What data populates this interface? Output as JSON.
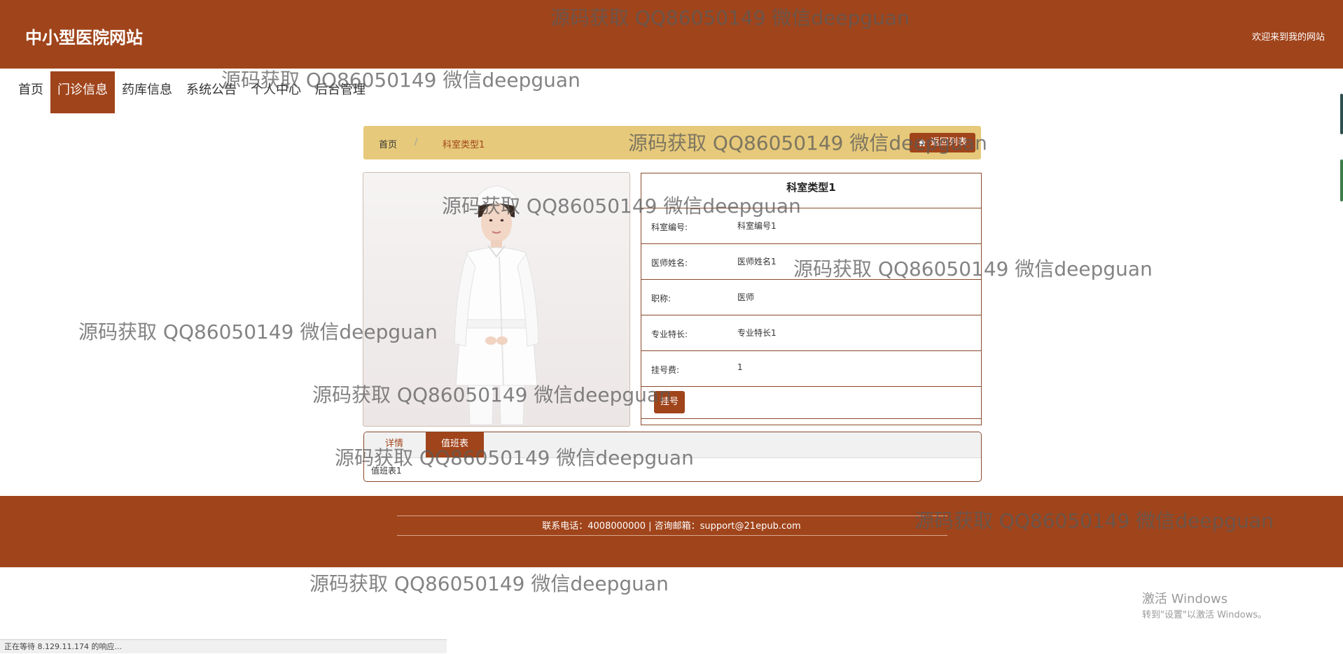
{
  "header": {
    "site_title": "中小型医院网站",
    "welcome": "欢迎来到我的网站"
  },
  "nav": [
    {
      "label": "首页",
      "active": false
    },
    {
      "label": "门诊信息",
      "active": true
    },
    {
      "label": "药库信息",
      "active": false
    },
    {
      "label": "系统公告",
      "active": false
    },
    {
      "label": "个人中心",
      "active": false
    },
    {
      "label": "后台管理",
      "active": false
    }
  ],
  "breadcrumb": {
    "home": "首页",
    "separator": "/",
    "current": "科室类型1",
    "back_label": "返回列表"
  },
  "details": {
    "title": "科室类型1",
    "rows": [
      {
        "label": "科室编号:",
        "value": "科室编号1"
      },
      {
        "label": "医师姓名:",
        "value": "医师姓名1"
      },
      {
        "label": "职称:",
        "value": "医师"
      },
      {
        "label": "专业特长:",
        "value": "专业特长1"
      },
      {
        "label": "挂号费:",
        "value": "1"
      }
    ],
    "register_button": "挂号"
  },
  "tabs": {
    "items": [
      "详情",
      "值班表"
    ],
    "active_index": 1,
    "content": "值班表1"
  },
  "footer": {
    "contact": "联系电话：4008000000 | 咨询邮箱：support@21epub.com"
  },
  "watermark_text": "源码获取 QQ86050149 微信deepguan",
  "os_overlay": {
    "activate_title": "激活 Windows",
    "activate_sub": "转到\"设置\"以激活 Windows。"
  },
  "status_bar": "正在等待 8.129.11.174 的响应...",
  "colors": {
    "brand": "#a0441b",
    "breadcrumb_bg": "#e6c97a",
    "footer_line": "#d9a88e"
  }
}
